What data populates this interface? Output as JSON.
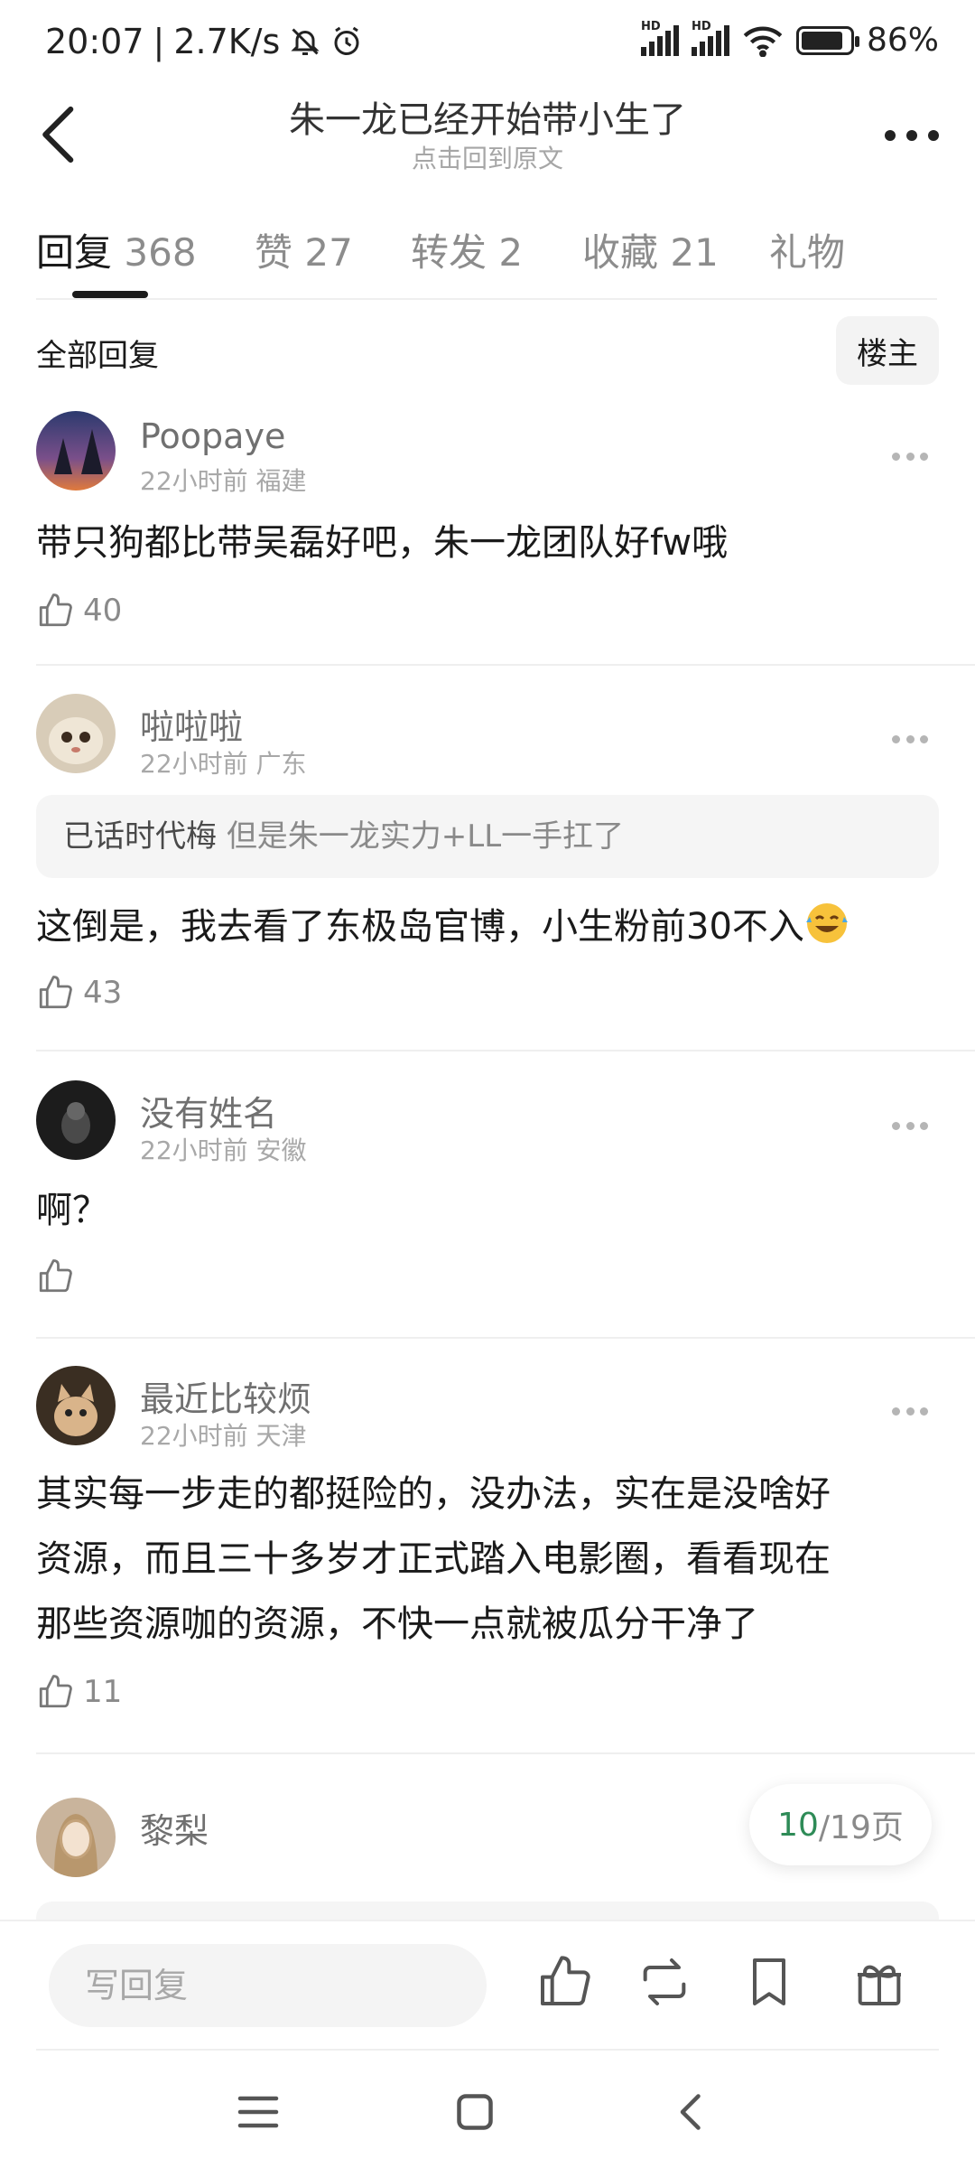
{
  "status_bar": {
    "time": "20:07",
    "speed": "2.7K/s",
    "battery": "86%",
    "battery_level": 0.86,
    "hd1": "HD",
    "hd2": "HD"
  },
  "header": {
    "title": "朱一龙已经开始带小生了",
    "subtitle": "点击回到原文"
  },
  "tabs": [
    {
      "label": "回复",
      "count": "368",
      "active": true
    },
    {
      "label": "赞",
      "count": "27"
    },
    {
      "label": "转发",
      "count": "2"
    },
    {
      "label": "收藏",
      "count": "21"
    },
    {
      "label": "礼物",
      "count": ""
    }
  ],
  "filter": {
    "label": "全部回复",
    "owner_button": "楼主"
  },
  "comments": [
    {
      "name": "Poopaye",
      "time": "22小时前",
      "location": "福建",
      "text": "带只狗都比带吴磊好吧，朱一龙团队好fw哦",
      "likes": "40"
    },
    {
      "name": "啦啦啦",
      "time": "22小时前",
      "location": "广东",
      "quote_name": "已话时代梅",
      "quote_text": "但是朱一龙实力+LL一手扛了",
      "text": "这倒是，我去看了东极岛官博，小生粉前30不入",
      "likes": "43"
    },
    {
      "name": "没有姓名",
      "time": "22小时前",
      "location": "安徽",
      "text": "啊？",
      "likes": ""
    },
    {
      "name": "最近比较烦",
      "time": "22小时前",
      "location": "天津",
      "text_lines": [
        "其实每一步走的都挺险的，没办法，实在是没啥好",
        "资源，而且三十多岁才正式踏入电影圈，看看现在",
        "那些资源咖的资源，不快一点就被瓜分干净了"
      ],
      "likes": "11"
    },
    {
      "name": "黎梨"
    }
  ],
  "pager": {
    "current": "10",
    "total": "/19页"
  },
  "bottom_bar": {
    "reply_placeholder": "写回复"
  },
  "colors": {
    "accent": "#2e8b57",
    "text": "#1a1a1a",
    "muted": "#8a8a8a"
  },
  "icons": [
    "back-arrow-icon",
    "more-icon",
    "thumb-up-icon",
    "repost-icon",
    "bookmark-icon",
    "gift-icon",
    "menu-icon",
    "home-square-icon",
    "back-nav-icon"
  ]
}
